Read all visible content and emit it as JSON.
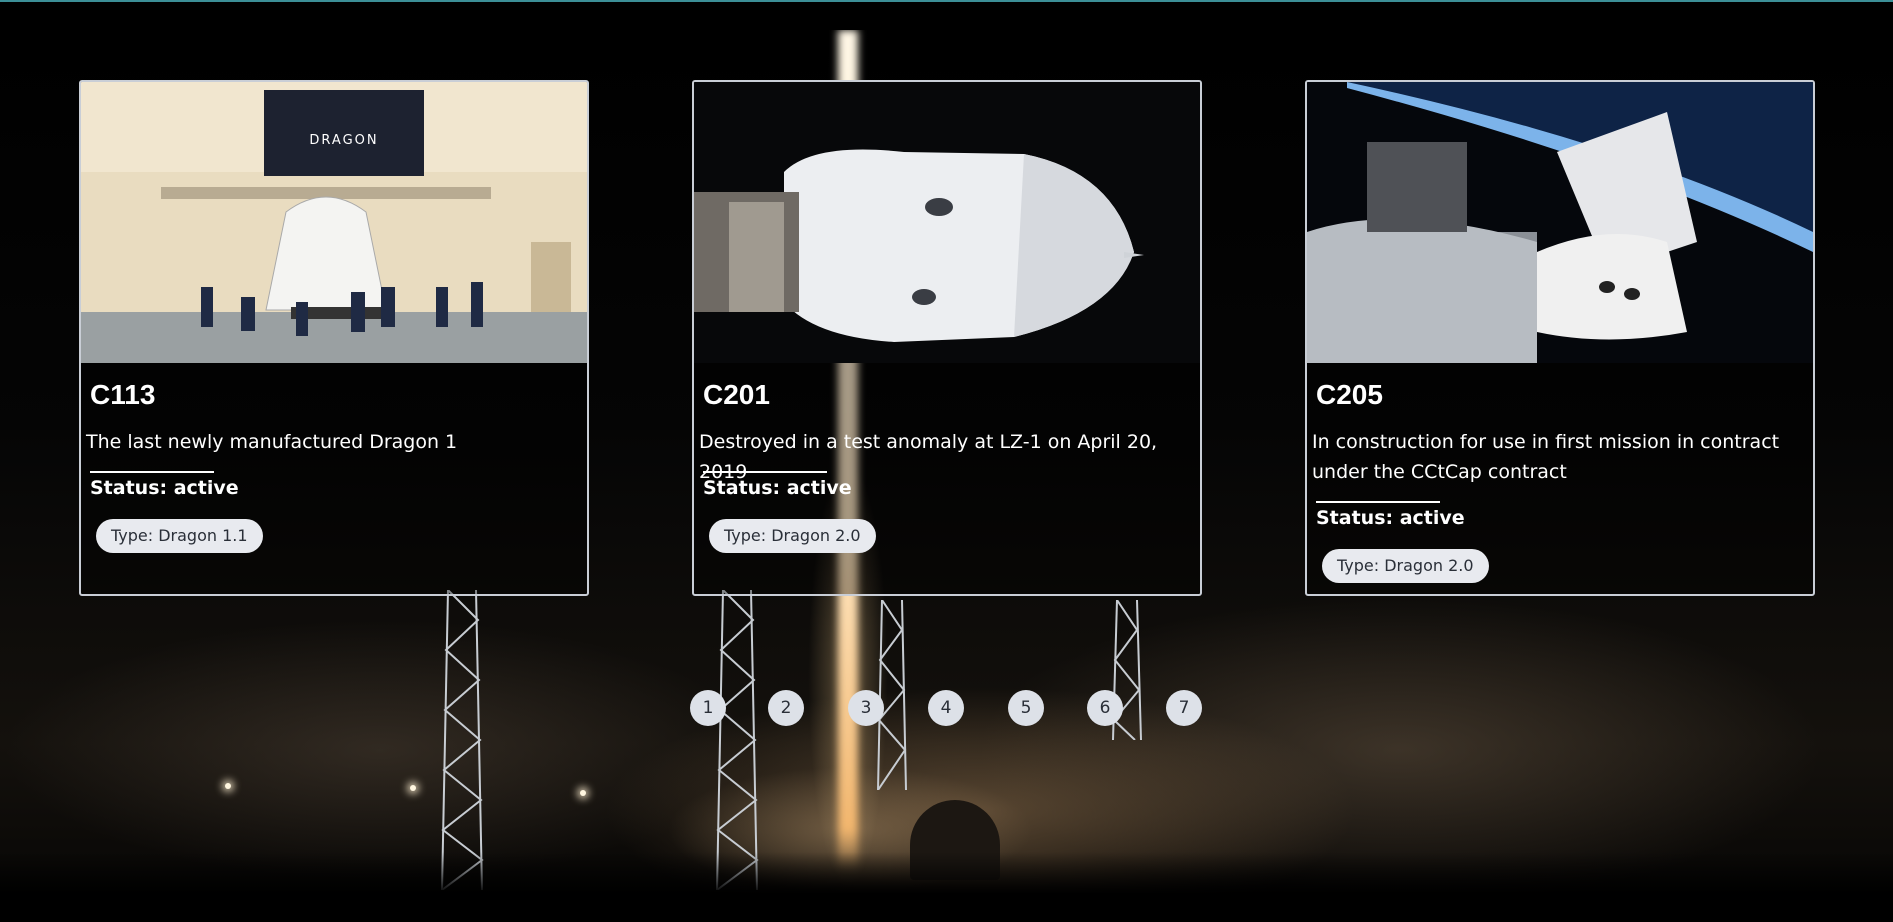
{
  "colors": {
    "accent_line": "#3c8f97",
    "card_border": "#c9ced6",
    "pill_bg": "#e8eaef",
    "pill_text": "#2a2f38"
  },
  "cards": [
    {
      "title": "C113",
      "description": "The last newly manufactured Dragon 1",
      "status": "Status: active",
      "type": "Type: Dragon 1.1",
      "image": "dragon-capsule-in-hangar"
    },
    {
      "title": "C201",
      "description": "Destroyed in a test anomaly at LZ-1 on April 20, 2019",
      "status": "Status: active",
      "type": "Type: Dragon 2.0",
      "image": "dragon-capsule-in-orbit"
    },
    {
      "title": "C205",
      "description": "In construction for use in first mission in contract under the CCtCap contract",
      "status": "Status: active",
      "type": "Type: Dragon 2.0",
      "image": "dragon-docked-to-station"
    }
  ],
  "pagination": {
    "pages": [
      "1",
      "2",
      "3",
      "4",
      "5",
      "6",
      "7"
    ]
  }
}
